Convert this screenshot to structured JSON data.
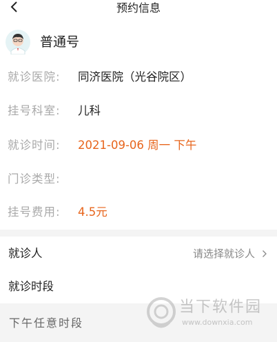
{
  "header": {
    "title": "预约信息",
    "back_icon": "chevron-left-icon"
  },
  "registration": {
    "type": "普通号",
    "avatar_icon": "doctor-avatar-icon"
  },
  "info": {
    "hospital": {
      "label": "就诊医院:",
      "value": "同济医院（光谷院区）"
    },
    "department": {
      "label": "挂号科室:",
      "value": "儿科"
    },
    "time": {
      "label": "就诊时间:",
      "value": "2021-09-06  周一  下午"
    },
    "clinic_type": {
      "label": "门诊类型:",
      "value": ""
    },
    "fee": {
      "label": "挂号费用:",
      "value": "4.5元"
    }
  },
  "patient": {
    "label": "就诊人",
    "placeholder": "请选择就诊人",
    "arrow_icon": "chevron-right-icon"
  },
  "time_slot": {
    "label": "就诊时段",
    "option": "下午任意时段"
  },
  "watermark": {
    "name": "当下软件园",
    "url": "www.downxia.com"
  },
  "colors": {
    "accent": "#e7641b",
    "label_gray": "#a9a9a9",
    "band": "#f4f4f4"
  }
}
